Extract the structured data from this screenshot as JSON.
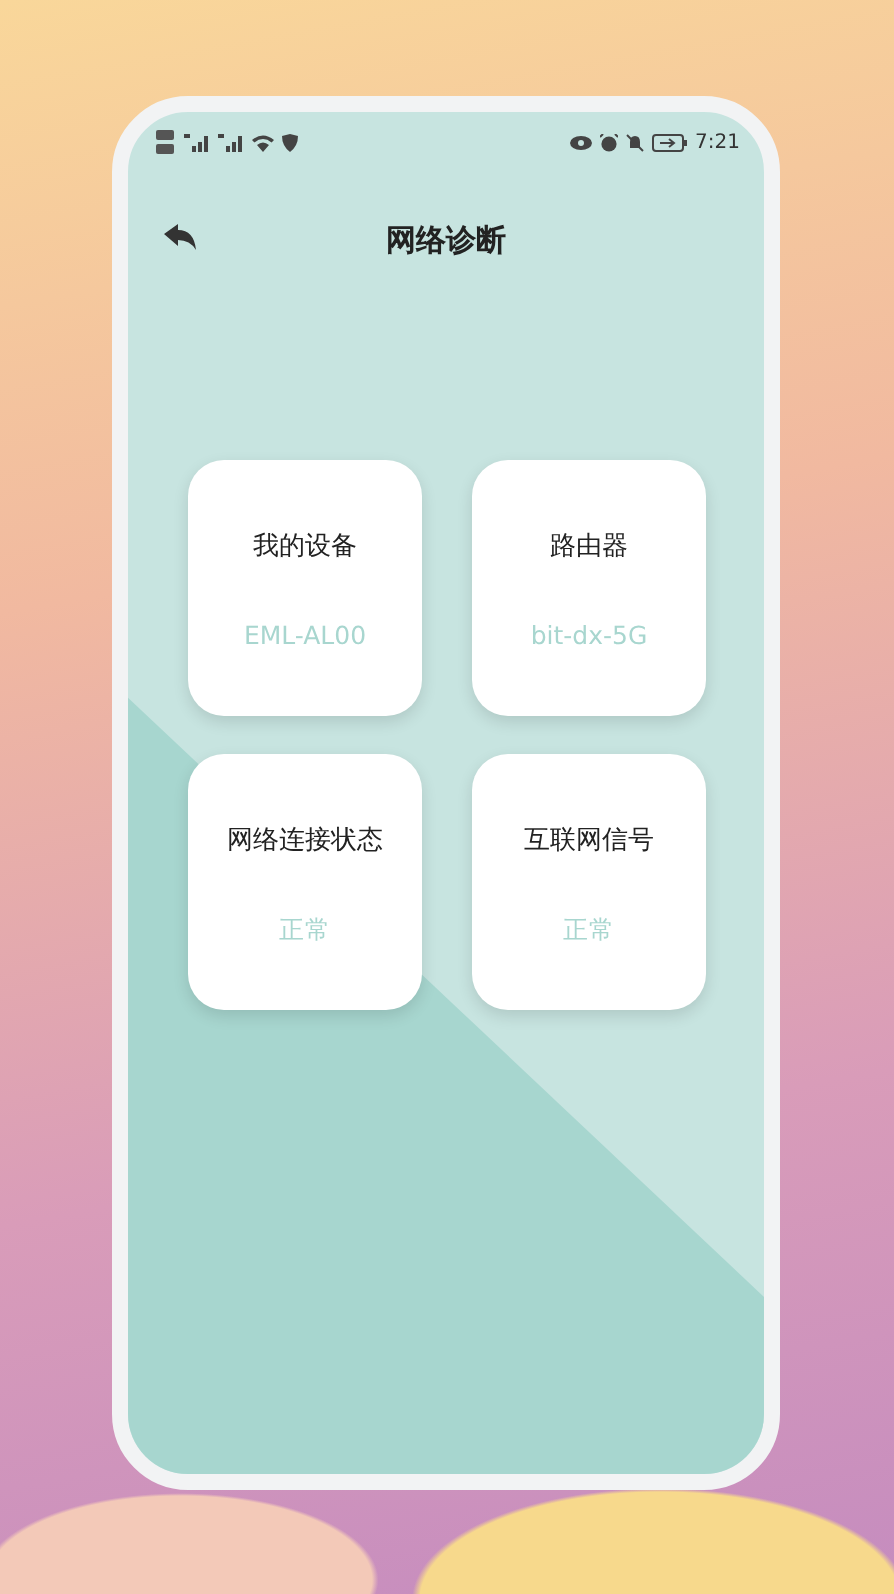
{
  "status_bar": {
    "time": "7:21"
  },
  "header": {
    "title": "网络诊断"
  },
  "cards": [
    {
      "title": "我的设备",
      "value": "EML-AL00"
    },
    {
      "title": "路由器",
      "value": "bit-dx-5G"
    },
    {
      "title": "网络连接状态",
      "value": "正常"
    },
    {
      "title": "互联网信号",
      "value": "正常"
    }
  ]
}
